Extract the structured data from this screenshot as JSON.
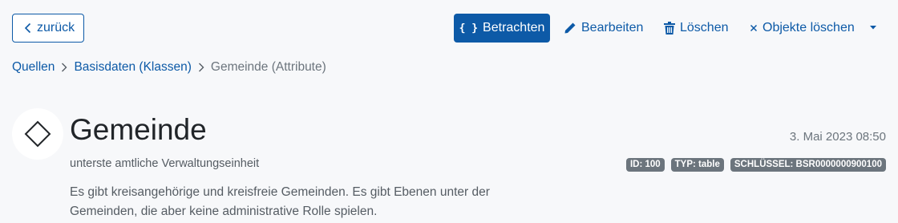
{
  "toolbar": {
    "back_label": "zurück",
    "view_label": "Betrachten",
    "view_icon": "{ }",
    "edit_label": "Bearbeiten",
    "delete_label": "Löschen",
    "delete_objects_label": "Objekte löschen"
  },
  "breadcrumb": {
    "items": [
      "Quellen",
      "Basisdaten (Klassen)"
    ],
    "current": "Gemeinde (Attribute)"
  },
  "header": {
    "title": "Gemeinde",
    "subtitle": "unterste amtliche Verwaltungseinheit",
    "description": "Es gibt kreisangehörige und kreisfreie Gemeinden. Es gibt Ebenen unter der Gemeinden, die aber keine administrative Rolle spielen.",
    "date": "3. Mai 2023 08:50",
    "badges": [
      "ID: 100",
      "TYP: table",
      "SCHLÜSSEL: BSR0000000900100"
    ]
  },
  "colors": {
    "primary": "#0d5aa7",
    "badge": "#6c757d",
    "background": "#f7f8fa"
  }
}
